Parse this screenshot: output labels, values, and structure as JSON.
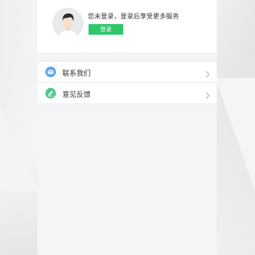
{
  "profile": {
    "avatar_icon": "user-avatar-icon",
    "login_hint": "您未登录，登录后享受更多服务",
    "login_button_label": "登录"
  },
  "menu": {
    "items": [
      {
        "label": "联系我们",
        "icon": "mail-icon",
        "icon_color": "#5aa6ee"
      },
      {
        "label": "意见反馈",
        "icon": "edit-icon",
        "icon_color": "#4fc98a"
      }
    ],
    "chevron_icon": "chevron-right-icon"
  },
  "colors": {
    "accent_green": "#2ec86a",
    "page_background": "#f4f5f7"
  }
}
